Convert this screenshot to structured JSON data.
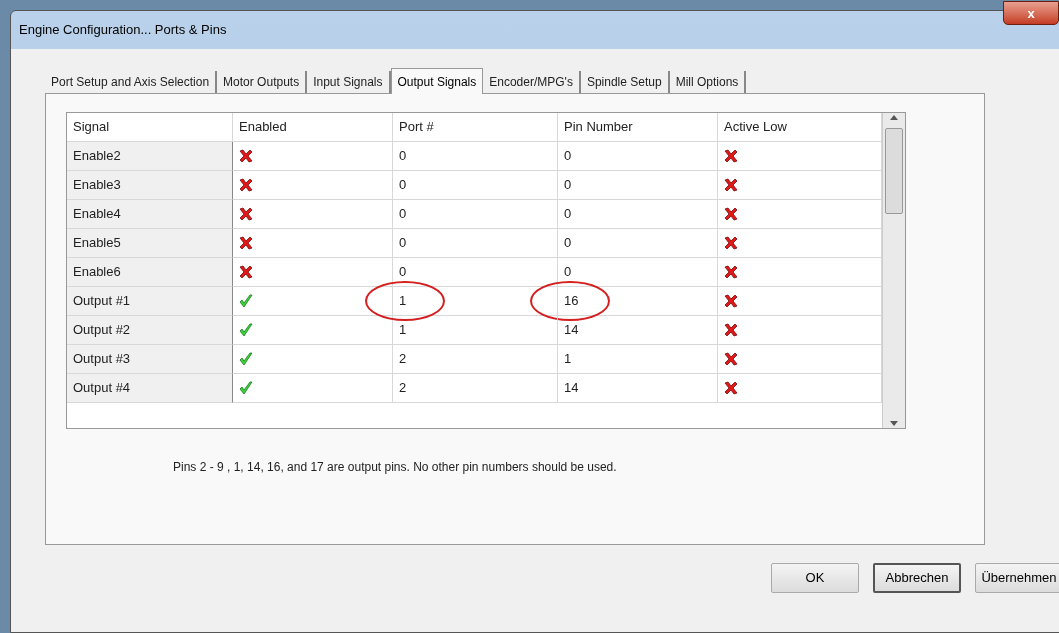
{
  "window": {
    "title": "Engine Configuration... Ports & Pins",
    "close": "x"
  },
  "tabs": [
    {
      "label": "Port Setup and Axis Selection",
      "selected": false
    },
    {
      "label": "Motor Outputs",
      "selected": false
    },
    {
      "label": "Input Signals",
      "selected": false
    },
    {
      "label": "Output Signals",
      "selected": true
    },
    {
      "label": "Encoder/MPG's",
      "selected": false
    },
    {
      "label": "Spindle Setup",
      "selected": false
    },
    {
      "label": "Mill Options",
      "selected": false
    }
  ],
  "table": {
    "columns": [
      "Signal",
      "Enabled",
      "Port #",
      "Pin Number",
      "Active Low"
    ],
    "rows": [
      {
        "signal": "Enable2",
        "enabled": false,
        "port": "0",
        "pin": "0",
        "active_low": false,
        "circled": false
      },
      {
        "signal": "Enable3",
        "enabled": false,
        "port": "0",
        "pin": "0",
        "active_low": false,
        "circled": false
      },
      {
        "signal": "Enable4",
        "enabled": false,
        "port": "0",
        "pin": "0",
        "active_low": false,
        "circled": false
      },
      {
        "signal": "Enable5",
        "enabled": false,
        "port": "0",
        "pin": "0",
        "active_low": false,
        "circled": false
      },
      {
        "signal": "Enable6",
        "enabled": false,
        "port": "0",
        "pin": "0",
        "active_low": false,
        "circled": false
      },
      {
        "signal": "Output #1",
        "enabled": true,
        "port": "1",
        "pin": "16",
        "active_low": false,
        "circled": true
      },
      {
        "signal": "Output #2",
        "enabled": true,
        "port": "1",
        "pin": "14",
        "active_low": false,
        "circled": false
      },
      {
        "signal": "Output #3",
        "enabled": true,
        "port": "2",
        "pin": "1",
        "active_low": false,
        "circled": false
      },
      {
        "signal": "Output #4",
        "enabled": true,
        "port": "2",
        "pin": "14",
        "active_low": false,
        "circled": false
      }
    ]
  },
  "note": "Pins 2 - 9 , 1, 14, 16, and 17 are output pins. No  other pin numbers should be used.",
  "buttons": [
    {
      "label": "OK",
      "focused": false
    },
    {
      "label": "Abbrechen",
      "focused": true
    },
    {
      "label": "Übernehmen",
      "focused": false
    }
  ]
}
